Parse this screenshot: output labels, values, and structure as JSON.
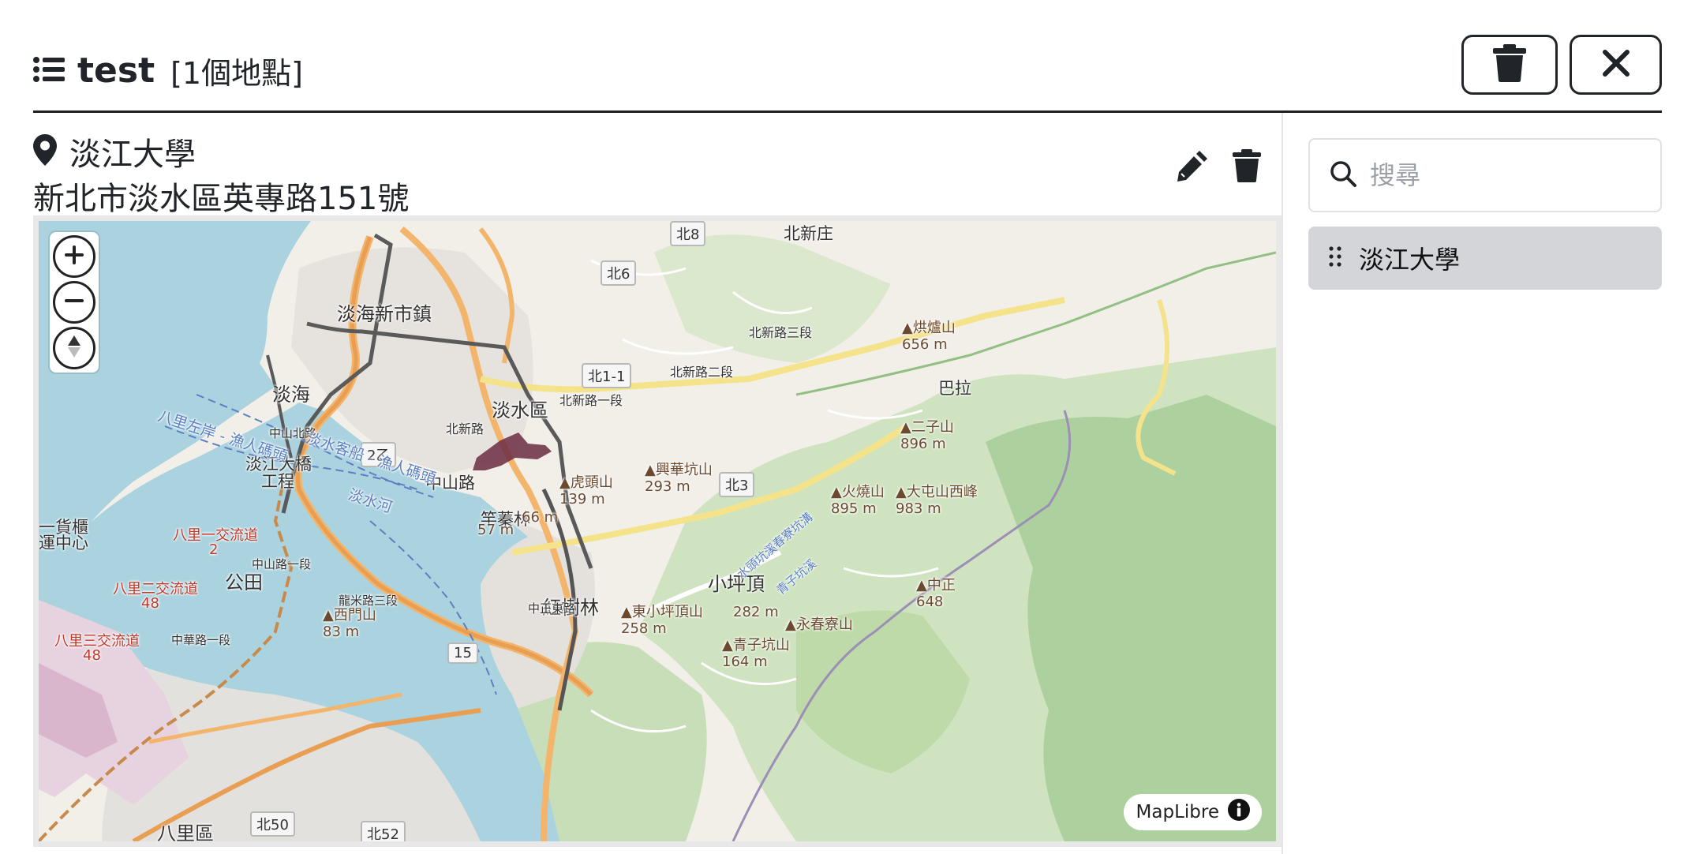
{
  "header": {
    "title": "test",
    "count": "[1個地點]",
    "icons": {
      "list": "list-icon",
      "delete": "trash-icon",
      "close": "close-icon"
    }
  },
  "location": {
    "name": "淡江大學",
    "address": "新北市淡水區英專路151號",
    "icons": {
      "pin": "map-pin-icon",
      "edit": "pencil-icon",
      "delete": "trash-icon"
    }
  },
  "map": {
    "attribution": "MapLibre",
    "controls": {
      "zoom_in": "+",
      "zoom_out": "−",
      "compass": "compass-icon"
    },
    "place_labels": [
      "淡海新市鎮",
      "淡海",
      "淡水區",
      "淡江大橋",
      "工程",
      "公田",
      "八里區",
      "紅樹林",
      "小坪頂",
      "一貨櫃",
      "運中心",
      "竿蓁林",
      "中山路"
    ],
    "road_shields": [
      "北8",
      "北6",
      "北1-1",
      "北3",
      "2乙",
      "15",
      "北50",
      "北52"
    ],
    "road_labels": [
      "北新庄",
      "北新路",
      "北新路一段",
      "北新路二段",
      "北新路三段",
      "中山北路",
      "中正東路",
      "中山路一段",
      "中華路一段",
      "龍米路三段",
      "八里一交流道",
      "八里二交流道",
      "八里三交流道"
    ],
    "water_labels": [
      "八里左岸 - 漁人碼頭",
      "淡水客船 - 漁人碼頭",
      "淡水河"
    ],
    "peaks": [
      {
        "name": "烘爐山",
        "elev": "656 m"
      },
      {
        "name": "二子山",
        "elev": "896 m"
      },
      {
        "name": "火燒山",
        "elev": "895 m"
      },
      {
        "name": "大屯山西峰",
        "elev": "983 m"
      },
      {
        "name": "興華坑山",
        "elev": "293 m"
      },
      {
        "name": "虎頭山",
        "elev": "139 m"
      },
      {
        "name": "西門山",
        "elev": "83 m"
      },
      {
        "name": "東小坪頂山",
        "elev": "258 m"
      },
      {
        "name": "青子坑山",
        "elev": "164 m"
      },
      {
        "name": "永春寮山",
        "elev": ""
      },
      {
        "name": "中正",
        "elev": "648"
      }
    ],
    "misc_labels": [
      "57 m",
      "66 m",
      "282 m",
      "2",
      "48",
      "48",
      "巴拉",
      "永春寮坑溝",
      "水頭坑溪",
      "青子坑溪",
      "北新庄"
    ],
    "colors": {
      "water": "#aad3df",
      "forest": "#add19e",
      "urban": "#e0dfdf",
      "highway": "#e89f53",
      "rail": "#555555",
      "selection": "#6b2c43"
    }
  },
  "sidebar": {
    "search_placeholder": "搜尋",
    "items": [
      {
        "label": "淡江大學",
        "icon": "drag-handle-icon"
      }
    ]
  }
}
